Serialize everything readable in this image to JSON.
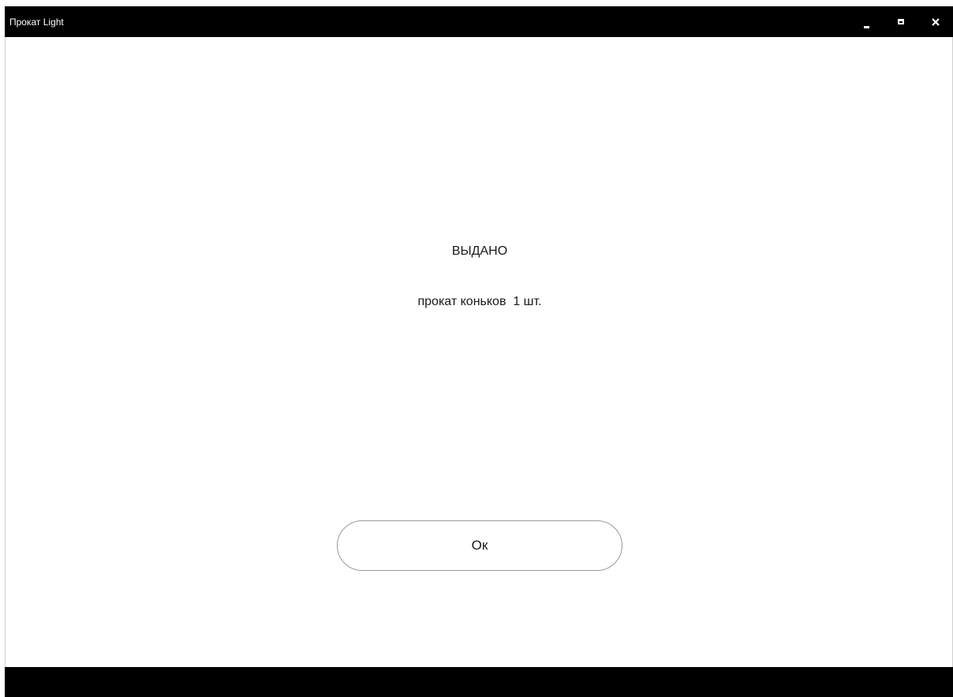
{
  "window": {
    "title": "Прокат Light",
    "controls": {
      "minimize_icon": "minimize-icon",
      "maximize_icon": "maximize-icon",
      "close_icon": "close-icon"
    }
  },
  "dialog": {
    "status": "ВЫДАНО",
    "message": "прокат коньков  1 шт.",
    "ok_label": "Ок"
  },
  "colors": {
    "chrome": "#000000",
    "background": "#ffffff",
    "button_border": "#9a9a9a",
    "text": "#1a1a1a"
  }
}
